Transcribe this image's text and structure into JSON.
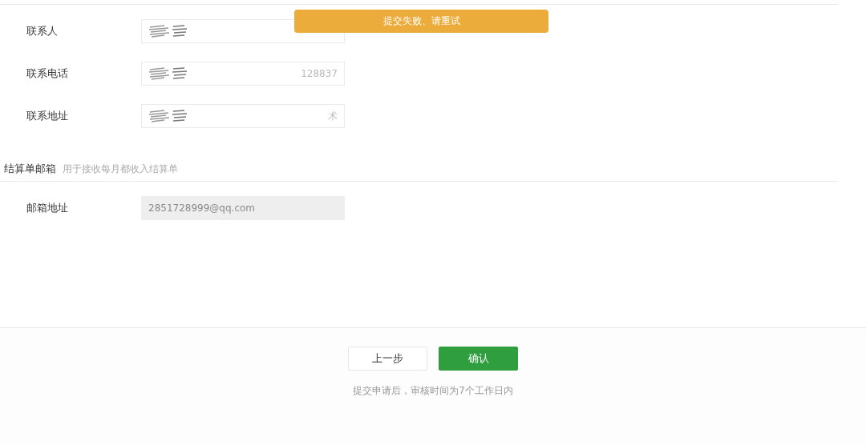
{
  "toast": {
    "text": "提交失败、请重试"
  },
  "contact_fields": [
    {
      "label": "联系人",
      "redacted": true,
      "disabled": false
    },
    {
      "label": "联系电话",
      "value": "128837",
      "redacted": true,
      "disabled": false
    },
    {
      "label": "联系地址",
      "value": "术",
      "redacted": true,
      "disabled": false
    }
  ],
  "billing_section": {
    "title": "结算单邮箱",
    "hint": "用于接收每月都收入结算单",
    "fields": [
      {
        "label": "邮箱地址",
        "value": "2851728999@qq.com",
        "redacted": false,
        "disabled": true
      }
    ]
  },
  "buttons": [
    {
      "label": "上一步",
      "kind": "secondary"
    },
    {
      "label": "确认",
      "kind": "primary"
    }
  ],
  "footer_note": "提交申请后，审核时间为7个工作日内"
}
